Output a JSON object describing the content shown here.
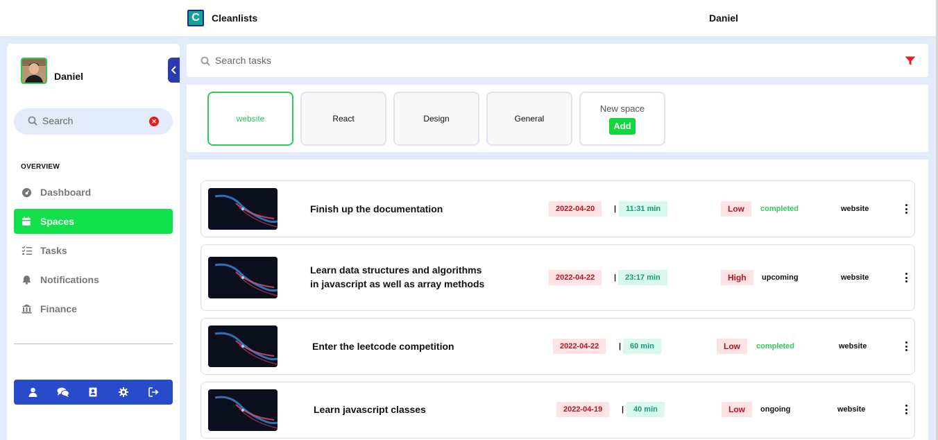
{
  "header": {
    "app_name": "Cleanlists",
    "logo_letter": "C",
    "user_name": "Daniel"
  },
  "sidebar": {
    "user_name": "Daniel",
    "search_placeholder": "Search",
    "section_label": "OVERVIEW",
    "items": [
      {
        "label": "Dashboard",
        "icon": "dashboard-icon",
        "active": false
      },
      {
        "label": "Spaces",
        "icon": "calendar-icon",
        "active": true
      },
      {
        "label": "Tasks",
        "icon": "checklist-icon",
        "active": false
      },
      {
        "label": "Notifications",
        "icon": "bell-icon",
        "active": false
      },
      {
        "label": "Finance",
        "icon": "bank-icon",
        "active": false
      }
    ],
    "bottom_actions": [
      "user-icon",
      "chat-icon",
      "contact-book-icon",
      "gear-icon",
      "logout-icon"
    ]
  },
  "main_search": {
    "placeholder": "Search tasks"
  },
  "spaces": {
    "items": [
      {
        "label": "website",
        "active": true
      },
      {
        "label": "React",
        "active": false
      },
      {
        "label": "Design",
        "active": false
      },
      {
        "label": "General",
        "active": false
      }
    ],
    "new_placeholder": "New space",
    "add_label": "Add"
  },
  "tasks": [
    {
      "title": "Finish up the documentation",
      "date": "2022-04-20",
      "duration": "11:31 min",
      "priority": "Low",
      "status": "completed",
      "space": "website"
    },
    {
      "title": "Learn data structures and algorithms in javascript as well as array methods",
      "date": "2022-04-22",
      "duration": "23:17 min",
      "priority": "High",
      "status": "upcoming",
      "space": "website"
    },
    {
      "title": "Enter the leetcode competition",
      "date": "2022-04-22",
      "duration": "60 min",
      "priority": "Low",
      "status": "completed",
      "space": "website"
    },
    {
      "title": "Learn javascript classes",
      "date": "2022-04-19",
      "duration": "40 min",
      "priority": "Low",
      "status": "ongoing",
      "space": "website"
    }
  ],
  "separator": "|",
  "colors": {
    "accent_green": "#12e04a",
    "brand_blue": "#2a4bc9",
    "danger_red": "#e81c1c"
  }
}
